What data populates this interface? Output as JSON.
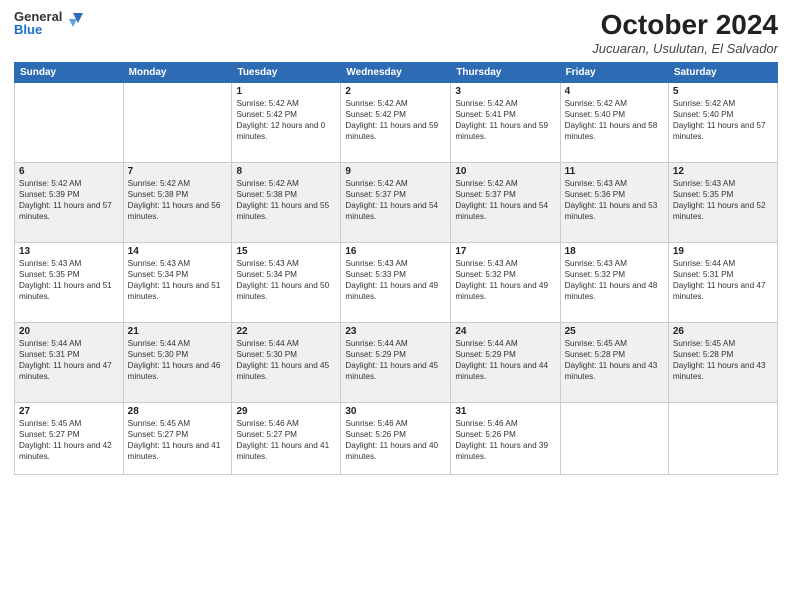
{
  "header": {
    "logo": {
      "line1": "General",
      "line2": "Blue"
    },
    "title": "October 2024",
    "location": "Jucuaran, Usulutan, El Salvador"
  },
  "days_of_week": [
    "Sunday",
    "Monday",
    "Tuesday",
    "Wednesday",
    "Thursday",
    "Friday",
    "Saturday"
  ],
  "weeks": [
    [
      {
        "num": "",
        "sunrise": "",
        "sunset": "",
        "daylight": ""
      },
      {
        "num": "",
        "sunrise": "",
        "sunset": "",
        "daylight": ""
      },
      {
        "num": "1",
        "sunrise": "Sunrise: 5:42 AM",
        "sunset": "Sunset: 5:42 PM",
        "daylight": "Daylight: 12 hours and 0 minutes."
      },
      {
        "num": "2",
        "sunrise": "Sunrise: 5:42 AM",
        "sunset": "Sunset: 5:42 PM",
        "daylight": "Daylight: 11 hours and 59 minutes."
      },
      {
        "num": "3",
        "sunrise": "Sunrise: 5:42 AM",
        "sunset": "Sunset: 5:41 PM",
        "daylight": "Daylight: 11 hours and 59 minutes."
      },
      {
        "num": "4",
        "sunrise": "Sunrise: 5:42 AM",
        "sunset": "Sunset: 5:40 PM",
        "daylight": "Daylight: 11 hours and 58 minutes."
      },
      {
        "num": "5",
        "sunrise": "Sunrise: 5:42 AM",
        "sunset": "Sunset: 5:40 PM",
        "daylight": "Daylight: 11 hours and 57 minutes."
      }
    ],
    [
      {
        "num": "6",
        "sunrise": "Sunrise: 5:42 AM",
        "sunset": "Sunset: 5:39 PM",
        "daylight": "Daylight: 11 hours and 57 minutes."
      },
      {
        "num": "7",
        "sunrise": "Sunrise: 5:42 AM",
        "sunset": "Sunset: 5:38 PM",
        "daylight": "Daylight: 11 hours and 56 minutes."
      },
      {
        "num": "8",
        "sunrise": "Sunrise: 5:42 AM",
        "sunset": "Sunset: 5:38 PM",
        "daylight": "Daylight: 11 hours and 55 minutes."
      },
      {
        "num": "9",
        "sunrise": "Sunrise: 5:42 AM",
        "sunset": "Sunset: 5:37 PM",
        "daylight": "Daylight: 11 hours and 54 minutes."
      },
      {
        "num": "10",
        "sunrise": "Sunrise: 5:42 AM",
        "sunset": "Sunset: 5:37 PM",
        "daylight": "Daylight: 11 hours and 54 minutes."
      },
      {
        "num": "11",
        "sunrise": "Sunrise: 5:43 AM",
        "sunset": "Sunset: 5:36 PM",
        "daylight": "Daylight: 11 hours and 53 minutes."
      },
      {
        "num": "12",
        "sunrise": "Sunrise: 5:43 AM",
        "sunset": "Sunset: 5:35 PM",
        "daylight": "Daylight: 11 hours and 52 minutes."
      }
    ],
    [
      {
        "num": "13",
        "sunrise": "Sunrise: 5:43 AM",
        "sunset": "Sunset: 5:35 PM",
        "daylight": "Daylight: 11 hours and 51 minutes."
      },
      {
        "num": "14",
        "sunrise": "Sunrise: 5:43 AM",
        "sunset": "Sunset: 5:34 PM",
        "daylight": "Daylight: 11 hours and 51 minutes."
      },
      {
        "num": "15",
        "sunrise": "Sunrise: 5:43 AM",
        "sunset": "Sunset: 5:34 PM",
        "daylight": "Daylight: 11 hours and 50 minutes."
      },
      {
        "num": "16",
        "sunrise": "Sunrise: 5:43 AM",
        "sunset": "Sunset: 5:33 PM",
        "daylight": "Daylight: 11 hours and 49 minutes."
      },
      {
        "num": "17",
        "sunrise": "Sunrise: 5:43 AM",
        "sunset": "Sunset: 5:32 PM",
        "daylight": "Daylight: 11 hours and 49 minutes."
      },
      {
        "num": "18",
        "sunrise": "Sunrise: 5:43 AM",
        "sunset": "Sunset: 5:32 PM",
        "daylight": "Daylight: 11 hours and 48 minutes."
      },
      {
        "num": "19",
        "sunrise": "Sunrise: 5:44 AM",
        "sunset": "Sunset: 5:31 PM",
        "daylight": "Daylight: 11 hours and 47 minutes."
      }
    ],
    [
      {
        "num": "20",
        "sunrise": "Sunrise: 5:44 AM",
        "sunset": "Sunset: 5:31 PM",
        "daylight": "Daylight: 11 hours and 47 minutes."
      },
      {
        "num": "21",
        "sunrise": "Sunrise: 5:44 AM",
        "sunset": "Sunset: 5:30 PM",
        "daylight": "Daylight: 11 hours and 46 minutes."
      },
      {
        "num": "22",
        "sunrise": "Sunrise: 5:44 AM",
        "sunset": "Sunset: 5:30 PM",
        "daylight": "Daylight: 11 hours and 45 minutes."
      },
      {
        "num": "23",
        "sunrise": "Sunrise: 5:44 AM",
        "sunset": "Sunset: 5:29 PM",
        "daylight": "Daylight: 11 hours and 45 minutes."
      },
      {
        "num": "24",
        "sunrise": "Sunrise: 5:44 AM",
        "sunset": "Sunset: 5:29 PM",
        "daylight": "Daylight: 11 hours and 44 minutes."
      },
      {
        "num": "25",
        "sunrise": "Sunrise: 5:45 AM",
        "sunset": "Sunset: 5:28 PM",
        "daylight": "Daylight: 11 hours and 43 minutes."
      },
      {
        "num": "26",
        "sunrise": "Sunrise: 5:45 AM",
        "sunset": "Sunset: 5:28 PM",
        "daylight": "Daylight: 11 hours and 43 minutes."
      }
    ],
    [
      {
        "num": "27",
        "sunrise": "Sunrise: 5:45 AM",
        "sunset": "Sunset: 5:27 PM",
        "daylight": "Daylight: 11 hours and 42 minutes."
      },
      {
        "num": "28",
        "sunrise": "Sunrise: 5:45 AM",
        "sunset": "Sunset: 5:27 PM",
        "daylight": "Daylight: 11 hours and 41 minutes."
      },
      {
        "num": "29",
        "sunrise": "Sunrise: 5:46 AM",
        "sunset": "Sunset: 5:27 PM",
        "daylight": "Daylight: 11 hours and 41 minutes."
      },
      {
        "num": "30",
        "sunrise": "Sunrise: 5:46 AM",
        "sunset": "Sunset: 5:26 PM",
        "daylight": "Daylight: 11 hours and 40 minutes."
      },
      {
        "num": "31",
        "sunrise": "Sunrise: 5:46 AM",
        "sunset": "Sunset: 5:26 PM",
        "daylight": "Daylight: 11 hours and 39 minutes."
      },
      {
        "num": "",
        "sunrise": "",
        "sunset": "",
        "daylight": ""
      },
      {
        "num": "",
        "sunrise": "",
        "sunset": "",
        "daylight": ""
      }
    ]
  ]
}
